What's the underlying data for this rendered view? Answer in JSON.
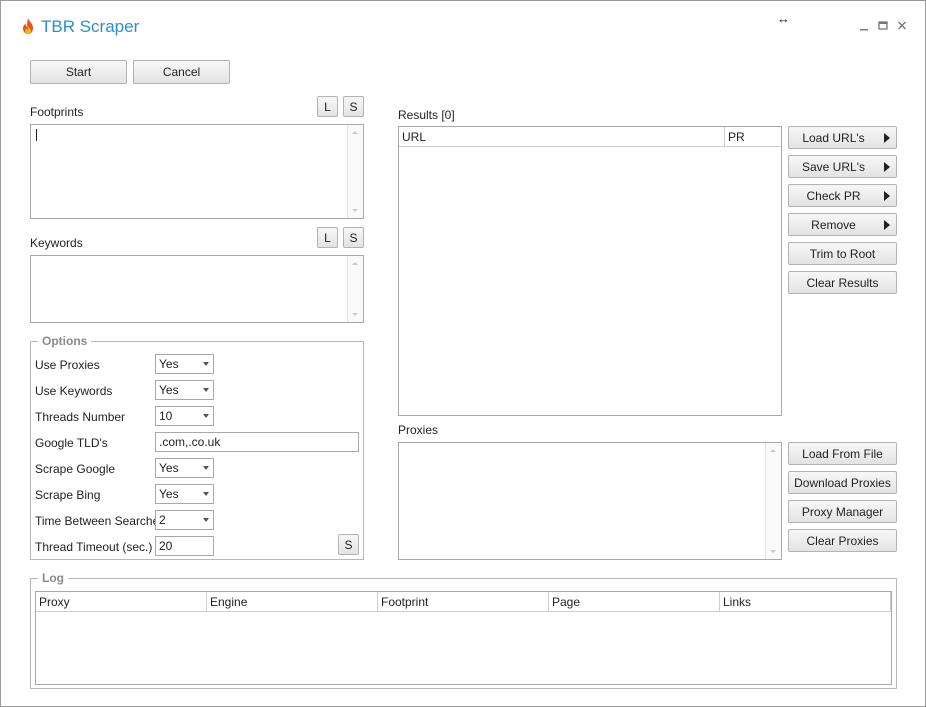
{
  "window": {
    "title": "TBR Scraper",
    "resize_icon": "↔",
    "minimize_icon": "minimize-icon",
    "maximize_icon": "maximize-icon",
    "close_icon": "close-icon",
    "accent": "#2b8fd1"
  },
  "toolbar": {
    "start_label": "Start",
    "cancel_label": "Cancel"
  },
  "footprints": {
    "label": "Footprints",
    "load_label": "L",
    "save_label": "S",
    "value": ""
  },
  "keywords": {
    "label": "Keywords",
    "load_label": "L",
    "save_label": "S",
    "value": ""
  },
  "options": {
    "title": "Options",
    "use_proxies": {
      "label": "Use Proxies",
      "value": "Yes"
    },
    "use_keywords": {
      "label": "Use Keywords",
      "value": "Yes"
    },
    "threads_number": {
      "label": "Threads Number",
      "value": "10"
    },
    "google_tlds": {
      "label": "Google TLD's",
      "value": ".com,.co.uk"
    },
    "scrape_google": {
      "label": "Scrape Google",
      "value": "Yes"
    },
    "scrape_bing": {
      "label": "Scrape Bing",
      "value": "Yes"
    },
    "time_between": {
      "label": "Time Between Searches",
      "value": "2"
    },
    "thread_timeout": {
      "label": "Thread Timeout (sec.)",
      "value": "20"
    },
    "save_label": "S"
  },
  "results": {
    "label": "Results [0]",
    "columns": [
      "URL",
      "PR"
    ],
    "buttons": {
      "load_urls": "Load URL's",
      "save_urls": "Save URL's",
      "check_pr": "Check PR",
      "remove": "Remove",
      "trim_root": "Trim to Root",
      "clear_results": "Clear Results"
    }
  },
  "proxies": {
    "label": "Proxies",
    "value": "",
    "buttons": {
      "load_file": "Load From File",
      "download": "Download Proxies",
      "manager": "Proxy Manager",
      "clear": "Clear Proxies"
    }
  },
  "log": {
    "title": "Log",
    "columns": [
      "Proxy",
      "Engine",
      "Footprint",
      "Page",
      "Links"
    ]
  }
}
